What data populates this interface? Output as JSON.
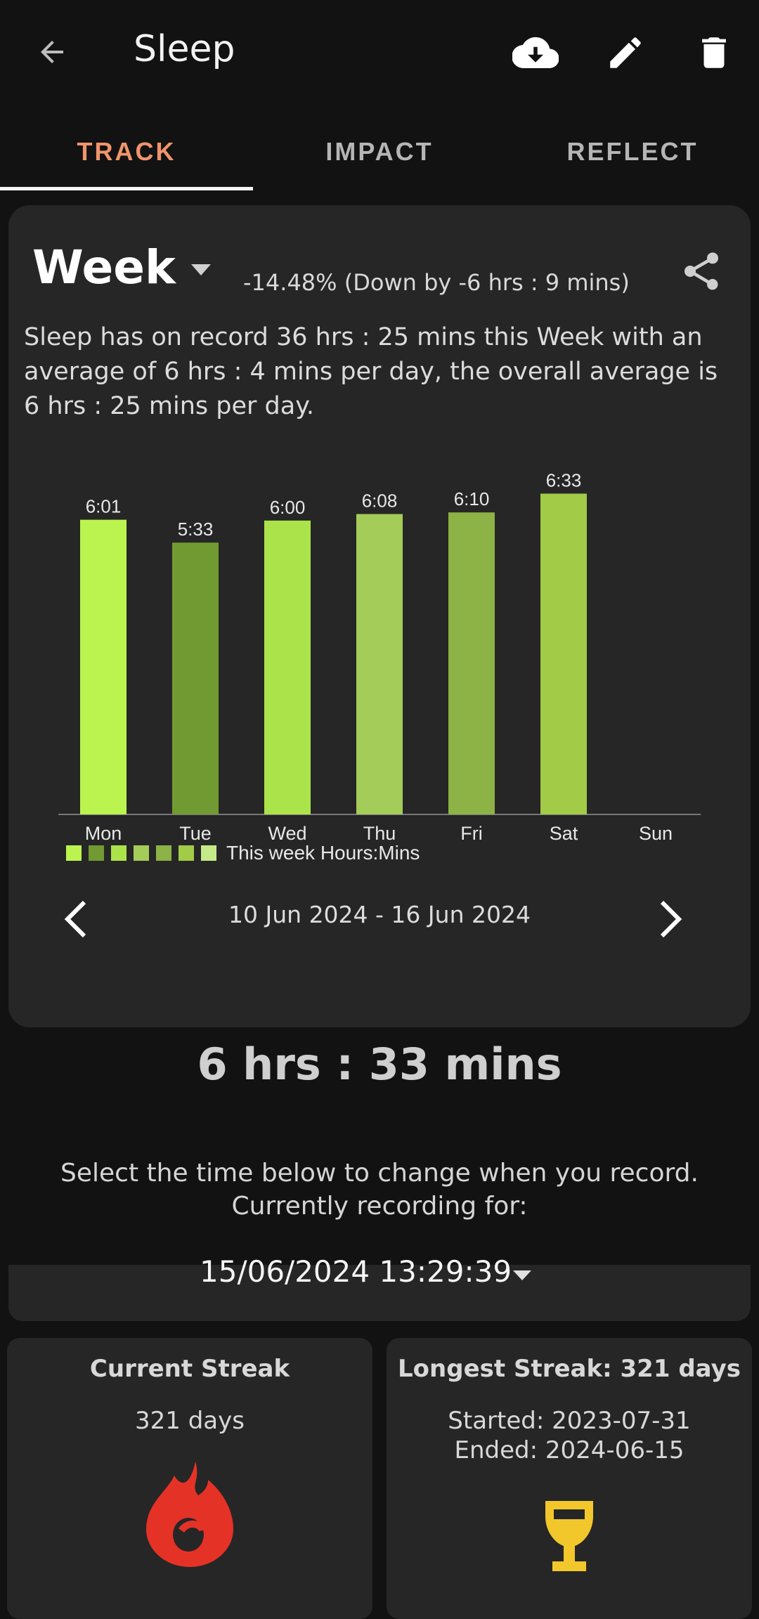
{
  "header": {
    "title": "Sleep",
    "back_icon": "arrow-left-icon",
    "actions": [
      "cloud-download-icon",
      "edit-pencil-icon",
      "trash-icon"
    ]
  },
  "tabs": [
    {
      "label": "TRACK",
      "active": true
    },
    {
      "label": "IMPACT"
    },
    {
      "label": "REFLECT"
    }
  ],
  "period": {
    "label": "Week",
    "change": "-14.48% (Down by -6 hrs : 9 mins)"
  },
  "summary": "Sleep has on record 36 hrs : 25 mins this Week with an average of 6 hrs : 4 mins per day, the overall average is 6 hrs : 25 mins per day.",
  "chart_data": {
    "type": "bar",
    "categories": [
      "Mon",
      "Tue",
      "Wed",
      "Thu",
      "Fri",
      "Sat",
      "Sun"
    ],
    "values": [
      6.0167,
      5.55,
      6.0,
      6.1333,
      6.1667,
      6.55,
      null
    ],
    "data_labels": [
      "6:01",
      "5:33",
      "6:00",
      "6:08",
      "6:10",
      "6:33",
      ""
    ],
    "colors": [
      "#bbf44e",
      "#729a33",
      "#abe34a",
      "#a4cc59",
      "#8db245",
      "#a2cb48",
      "#000000"
    ],
    "legend": "This week Hours:Mins",
    "legend_colors": [
      "#bbf44e",
      "#729a33",
      "#abe34a",
      "#a4cc59",
      "#8db245",
      "#a2cb48",
      "#c5ea8a"
    ],
    "ylim": [
      0,
      6.6
    ],
    "grid": false
  },
  "date_range": "10 Jun 2024 - 16 Jun 2024",
  "selected_value": "6 hrs : 33 mins",
  "record": {
    "line1": "Select the time below to change when you record.",
    "line2": "Currently recording for:",
    "datetime": "15/06/2024 13:29:39"
  },
  "streaks": {
    "current_title": "Current Streak",
    "current_value": "321 days",
    "longest_title": "Longest Streak: 321 days",
    "started": "Started: 2023-07-31",
    "ended": "Ended: 2024-06-15"
  },
  "colors": {
    "accent_tab": "#f0956b",
    "flame": "#e53227",
    "trophy": "#f2c72c"
  }
}
